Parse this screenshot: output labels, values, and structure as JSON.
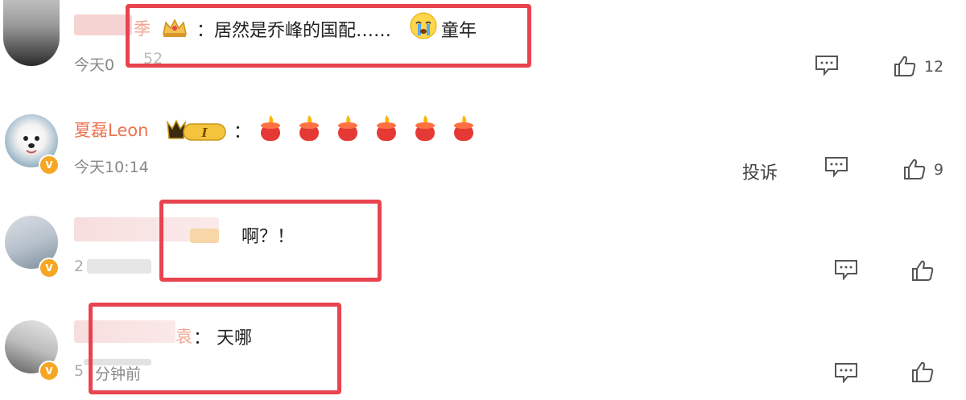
{
  "comments": [
    {
      "name_visible": "季",
      "text": "：居然是乔峰的国配……",
      "emoji_after": "童年",
      "time": "今天0",
      "time_partial": "52",
      "likes": "12"
    },
    {
      "name": "夏磊Leon",
      "level_badge": "I",
      "separator": "：",
      "time": "今天10:14",
      "report": "投诉",
      "likes": "9",
      "candles": 6
    },
    {
      "text": "啊？！",
      "time_partial": "2"
    },
    {
      "name_visible": "袁",
      "text": "：  天哪",
      "time": "分钟前",
      "time_partial": "5"
    }
  ],
  "colors": {
    "username": "#eb7350",
    "highlight_box": "#e8434f",
    "verified_badge": "#f5a623"
  }
}
